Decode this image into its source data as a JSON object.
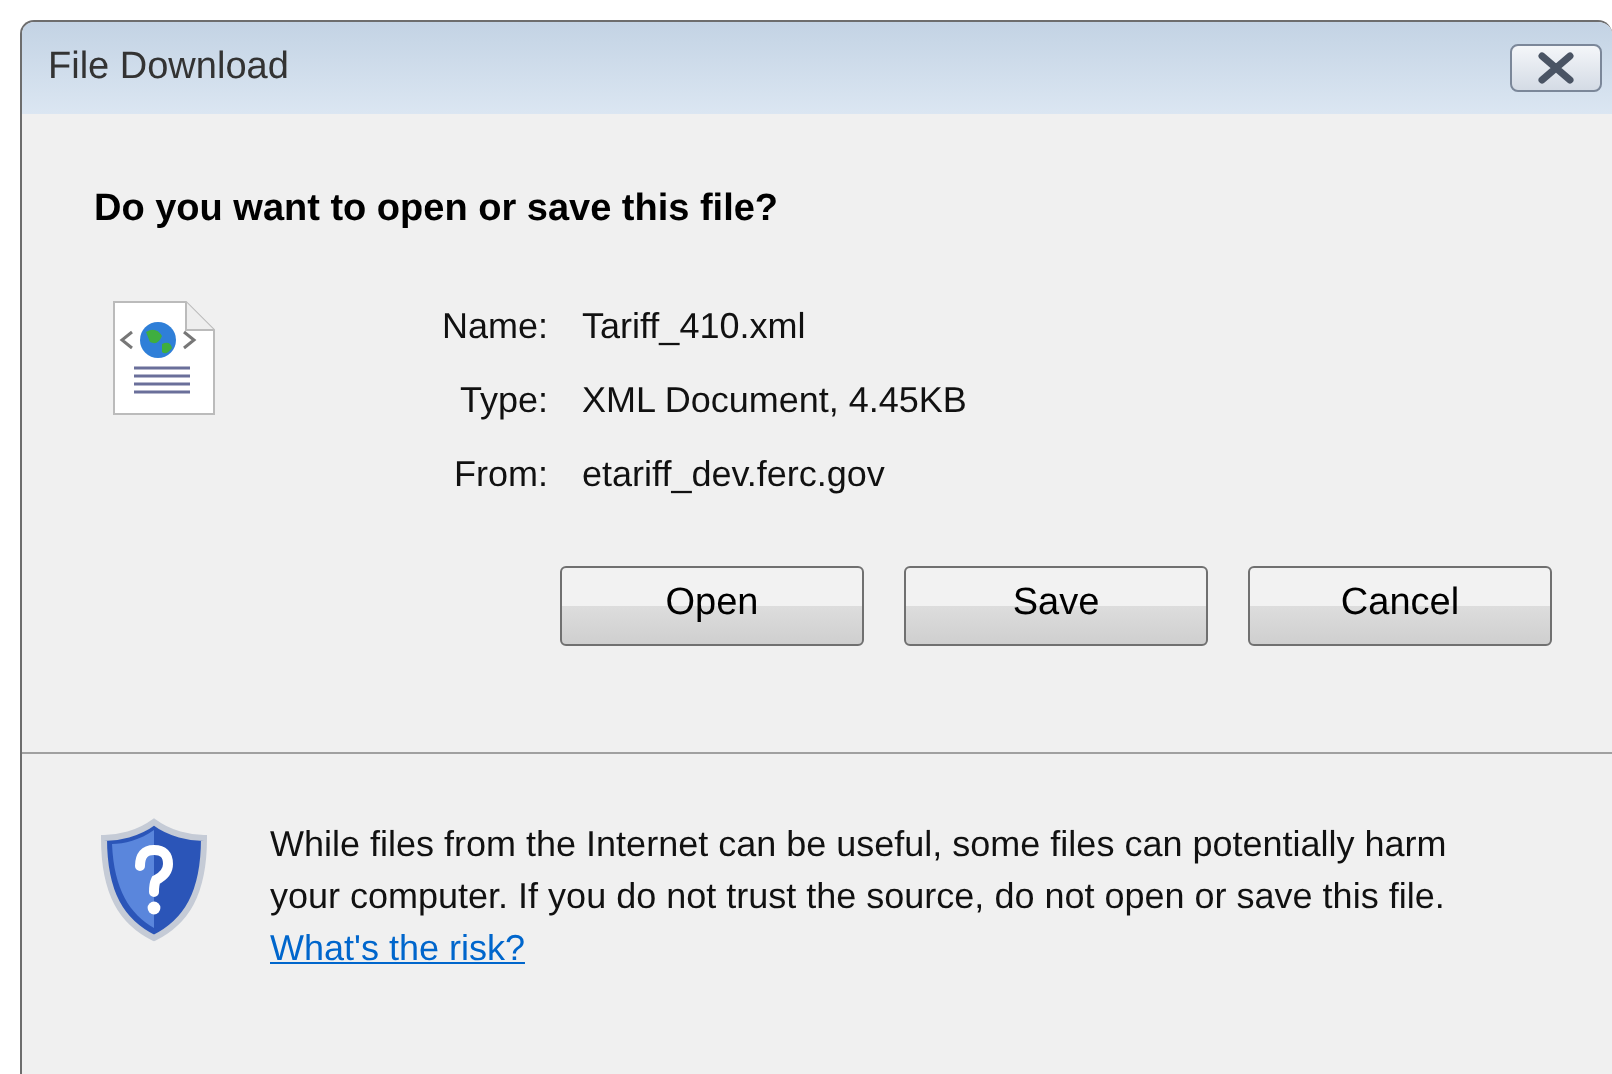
{
  "window": {
    "title": "File Download"
  },
  "heading": "Do you want to open or save this file?",
  "details": [
    {
      "label": "Name:",
      "value": "Tariff_410.xml"
    },
    {
      "label": "Type:",
      "value": "XML Document, 4.45KB"
    },
    {
      "label": "From:",
      "value": "etariff_dev.ferc.gov"
    }
  ],
  "buttons": [
    "Open",
    "Save",
    "Cancel"
  ],
  "warning": {
    "text": "While files from the Internet can be useful, some files can potentially harm your computer. If you do not trust the source, do not open or save this file.",
    "link": "What's the risk?"
  }
}
